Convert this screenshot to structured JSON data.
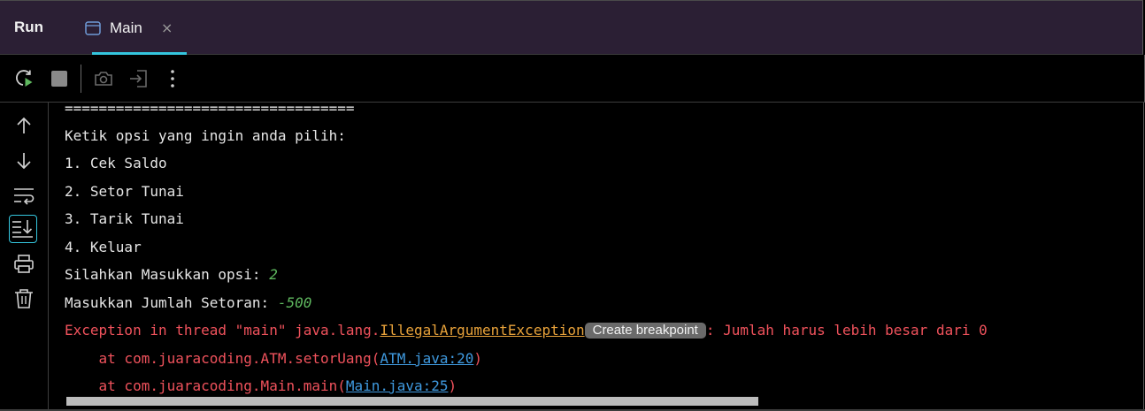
{
  "header": {
    "title": "Run",
    "tab": {
      "label": "Main",
      "icon": "console-window-icon",
      "close_icon": "close-icon",
      "close_glyph": "×"
    }
  },
  "toolbar": {
    "buttons": [
      {
        "name": "rerun-button",
        "icon": "rerun-icon",
        "enabled": true
      },
      {
        "name": "stop-button",
        "icon": "stop-icon",
        "enabled": true
      },
      {
        "name": "screenshot-button",
        "icon": "camera-icon",
        "enabled": false
      },
      {
        "name": "exit-button",
        "icon": "exit-icon",
        "enabled": false
      },
      {
        "name": "more-options-button",
        "icon": "more-vertical-icon",
        "enabled": true
      }
    ]
  },
  "sidebar": {
    "buttons": [
      {
        "name": "scroll-up-button",
        "icon": "arrow-up-icon"
      },
      {
        "name": "scroll-down-button",
        "icon": "arrow-down-icon"
      },
      {
        "name": "soft-wrap-button",
        "icon": "soft-wrap-icon"
      },
      {
        "name": "scroll-to-end-button",
        "icon": "scroll-to-end-icon",
        "active": true
      },
      {
        "name": "print-button",
        "icon": "print-icon"
      },
      {
        "name": "clear-all-button",
        "icon": "trash-icon"
      }
    ]
  },
  "console": {
    "separator": "==================================",
    "prompt": "Ketik opsi yang ingin anda pilih:",
    "options": [
      "1. Cek Saldo",
      "2. Setor Tunai",
      "3. Tarik Tunai",
      "4. Keluar"
    ],
    "choice_prompt": "Silahkan Masukkan opsi: ",
    "choice_value": "2",
    "amount_prompt": "Masukkan Jumlah Setoran: ",
    "amount_value": "-500",
    "exception": {
      "prefix": "Exception in thread \"main\" java.lang.",
      "class_name": "IllegalArgumentException",
      "breakpoint_label": "Create breakpoint",
      "message": ": Jumlah harus lebih besar dari 0"
    },
    "stack": [
      {
        "prefix": "    at com.juaracoding.ATM.setorUang(",
        "link": "ATM.java:20",
        "suffix": ")"
      },
      {
        "prefix": "    at com.juaracoding.Main.main(",
        "link": "Main.java:25",
        "suffix": ")"
      }
    ]
  },
  "colors": {
    "accent": "#34c6de",
    "error": "#f0525c",
    "user_input": "#5fb85f",
    "exception_link": "#e8a23a",
    "source_link": "#3f9ae0",
    "header_bg": "#2b1f34"
  }
}
